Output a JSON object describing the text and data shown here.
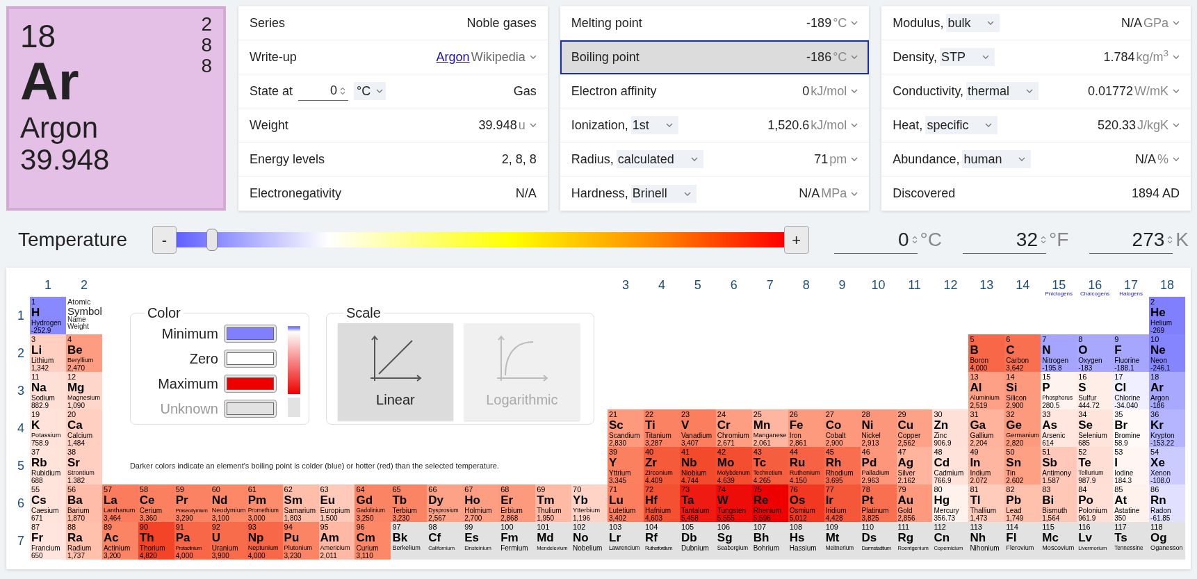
{
  "element_card": {
    "number": "18",
    "shells": [
      "2",
      "8",
      "8"
    ],
    "symbol": "Ar",
    "name": "Argon",
    "weight": "39.948"
  },
  "property_panels": [
    {
      "rows": [
        {
          "kind": "plain",
          "label": "Series",
          "value": "Noble gases",
          "menu": false
        },
        {
          "kind": "link",
          "label": "Write-up",
          "link": "Argon",
          "value": "Wikipedia",
          "menu": true
        },
        {
          "kind": "state",
          "label": "State at",
          "input": "0",
          "option": "°C",
          "value": "Gas",
          "menu": false
        },
        {
          "kind": "plain",
          "label": "Weight",
          "value": "39.948",
          "unit": "u",
          "menu": true
        },
        {
          "kind": "plain",
          "label": "Energy levels",
          "value": "2, 8, 8",
          "menu": false
        },
        {
          "kind": "plain",
          "label": "Electronegativity",
          "value": "N/A",
          "menu": false
        }
      ]
    },
    {
      "rows": [
        {
          "kind": "plain",
          "label": "Melting point",
          "value": "-189",
          "unit": "°C",
          "menu": true,
          "selected": false
        },
        {
          "kind": "plain",
          "label": "Boiling point",
          "value": "-186",
          "unit": "°C",
          "menu": true,
          "selected": true
        },
        {
          "kind": "plain",
          "label": "Electron affinity",
          "value": "0",
          "unit": "kJ/mol",
          "menu": true,
          "selected": false
        },
        {
          "kind": "plain",
          "label": "Ionization,",
          "option": "1st",
          "value": "1,520.6",
          "unit": "kJ/mol",
          "menu": true,
          "selected": false
        },
        {
          "kind": "plain",
          "label": "Radius,",
          "option": "calculated",
          "value": "71",
          "unit": "pm",
          "menu": true,
          "selected": false
        },
        {
          "kind": "plain",
          "label": "Hardness,",
          "option": "Brinell",
          "value": "N/A",
          "unit": "MPa",
          "menu": true,
          "selected": false
        }
      ]
    },
    {
      "rows": [
        {
          "kind": "plain",
          "label": "Modulus,",
          "option": "bulk",
          "value": "N/A",
          "unit": "GPa",
          "menu": true,
          "selected": false
        },
        {
          "kind": "plain",
          "label": "Density,",
          "option": "STP",
          "value": "1.784",
          "unit": "kg/m$^{3}$",
          "menu": true,
          "selected": false
        },
        {
          "kind": "plain",
          "label": "Conductivity,",
          "option": "thermal",
          "value": "0.01772",
          "unit": "W/mK",
          "menu": true,
          "selected": false
        },
        {
          "kind": "plain",
          "label": "Heat,",
          "option": "specific",
          "value": "520.33",
          "unit": "J/kgK",
          "menu": true,
          "selected": false
        },
        {
          "kind": "plain",
          "label": "Abundance,",
          "option": "human",
          "value": "N/A",
          "unit": "%",
          "menu": true,
          "selected": false
        },
        {
          "kind": "plain",
          "label": "Discovered",
          "value": "1894 AD",
          "menu": false,
          "selected": false
        }
      ]
    }
  ],
  "temperature": {
    "label": "Temperature",
    "minus": "-",
    "plus": "+",
    "level": 0.05,
    "fields": [
      {
        "value": "0",
        "unit": "°C"
      },
      {
        "value": "32",
        "unit": "°F"
      },
      {
        "value": "273",
        "unit": "K"
      }
    ]
  },
  "table": {
    "groups": [
      {
        "label": "1"
      },
      {
        "label": "2"
      },
      {
        "label": "3"
      },
      {
        "label": "4"
      },
      {
        "label": "5"
      },
      {
        "label": "6"
      },
      {
        "label": "7"
      },
      {
        "label": "8"
      },
      {
        "label": "9"
      },
      {
        "label": "10"
      },
      {
        "label": "11"
      },
      {
        "label": "12"
      },
      {
        "label": "13"
      },
      {
        "label": "14"
      },
      {
        "label": "15",
        "family": "Pnictogens"
      },
      {
        "label": "16",
        "family": "Chalcogens"
      },
      {
        "label": "17",
        "family": "Halogens"
      },
      {
        "label": "18"
      }
    ],
    "periods": [
      "1",
      "2",
      "3",
      "4",
      "5",
      "6",
      "7"
    ],
    "key": {
      "number": "Atomic",
      "symbol": "Symbol",
      "name": "Name",
      "value": "Weight"
    },
    "color_panel": {
      "title": "Color",
      "items": [
        {
          "label": "Minimum",
          "color": "#8080ff",
          "disabled": false
        },
        {
          "label": "Zero",
          "color": "#ffffff",
          "disabled": false
        },
        {
          "label": "Maximum",
          "color": "#ee0000",
          "disabled": false
        },
        {
          "label": "Unknown",
          "color": "#e2e2e2",
          "disabled": true
        }
      ]
    },
    "scale_panel": {
      "title": "Scale",
      "options": [
        {
          "kind": "linear",
          "label": "Linear",
          "selected": true
        },
        {
          "kind": "logarithmic",
          "label": "Logarithmic",
          "selected": false
        }
      ]
    },
    "note": "Darker colors indicate an element's boiling point is colder (blue) or hotter (red) than the selected temperature.",
    "elements": [
      {
        "number": "1",
        "symbol": "H",
        "name": "Hydrogen",
        "value": "-252.9",
        "color": "#8888ff"
      },
      {
        "number": "2",
        "symbol": "He",
        "name": "Helium",
        "value": "-269",
        "color": "#8080ff"
      },
      {
        "number": "3",
        "symbol": "Li",
        "name": "Lithium",
        "value": "1,342",
        "color": "#ffcfc1"
      },
      {
        "number": "4",
        "symbol": "Be",
        "name": "Beryllium",
        "value": "2,470",
        "color": "#fd9c80"
      },
      {
        "number": "5",
        "symbol": "B",
        "name": "Boron",
        "value": "4,000",
        "color": "#f86848"
      },
      {
        "number": "6",
        "symbol": "C",
        "name": "Carbon",
        "value": "3,642",
        "color": "#f87050"
      },
      {
        "number": "7",
        "symbol": "N",
        "name": "Nitrogen",
        "value": "-195.8",
        "color": "#a5a5ff"
      },
      {
        "number": "8",
        "symbol": "O",
        "name": "Oxygen",
        "value": "-183",
        "color": "#a8a8ff"
      },
      {
        "number": "9",
        "symbol": "F",
        "name": "Fluorine",
        "value": "-188.1",
        "color": "#a6a6ff"
      },
      {
        "number": "10",
        "symbol": "Ne",
        "name": "Neon",
        "value": "-246.1",
        "color": "#8585ff"
      },
      {
        "number": "11",
        "symbol": "Na",
        "name": "Sodium",
        "value": "882.9",
        "color": "#ffe0d8"
      },
      {
        "number": "12",
        "symbol": "Mg",
        "name": "Magnesium",
        "value": "1,090",
        "color": "#ffd6ca"
      },
      {
        "number": "13",
        "symbol": "Al",
        "name": "Aluminium",
        "value": "2,519",
        "color": "#fda085"
      },
      {
        "number": "14",
        "symbol": "Si",
        "name": "Silicon",
        "value": "2,900",
        "color": "#fd9a7e"
      },
      {
        "number": "15",
        "symbol": "P",
        "name": "Phosphorus",
        "value": "280.5",
        "color": "#fff3ef"
      },
      {
        "number": "16",
        "symbol": "S",
        "name": "Sulfur",
        "value": "444.72",
        "color": "#ffeee8"
      },
      {
        "number": "17",
        "symbol": "Cl",
        "name": "Chlorine",
        "value": "-34.040",
        "color": "#efefff"
      },
      {
        "number": "18",
        "symbol": "Ar",
        "name": "Argon",
        "value": "-186",
        "color": "#a8a8ff"
      },
      {
        "number": "19",
        "symbol": "K",
        "name": "Potassium",
        "value": "758.9",
        "color": "#ffe3db"
      },
      {
        "number": "20",
        "symbol": "Ca",
        "name": "Calcium",
        "value": "1,484",
        "color": "#ffcfc1"
      },
      {
        "number": "21",
        "symbol": "Sc",
        "name": "Scandium",
        "value": "2,830",
        "color": "#fd9a7e"
      },
      {
        "number": "22",
        "symbol": "Ti",
        "name": "Titanium",
        "value": "3,287",
        "color": "#fb8262"
      },
      {
        "number": "23",
        "symbol": "V",
        "name": "Vanadium",
        "value": "3,407",
        "color": "#fb7e5e"
      },
      {
        "number": "24",
        "symbol": "Cr",
        "name": "Chromium",
        "value": "2,671",
        "color": "#fd9e82"
      },
      {
        "number": "25",
        "symbol": "Mn",
        "name": "Manganese",
        "value": "2,061",
        "color": "#ffb6a0"
      },
      {
        "number": "26",
        "symbol": "Fe",
        "name": "Iron",
        "value": "2,861",
        "color": "#fd9a7e"
      },
      {
        "number": "27",
        "symbol": "Co",
        "name": "Cobalt",
        "value": "2,900",
        "color": "#fd987c"
      },
      {
        "number": "28",
        "symbol": "Ni",
        "name": "Nickel",
        "value": "2,913",
        "color": "#fd977b"
      },
      {
        "number": "29",
        "symbol": "Cu",
        "name": "Copper",
        "value": "2,562",
        "color": "#fda286"
      },
      {
        "number": "30",
        "symbol": "Zn",
        "name": "Zinc",
        "value": "906.9",
        "color": "#ffe0d8"
      },
      {
        "number": "31",
        "symbol": "Ga",
        "name": "Gallium",
        "value": "2,204",
        "color": "#ffb29c"
      },
      {
        "number": "32",
        "symbol": "Ge",
        "name": "Germanium",
        "value": "2,820",
        "color": "#fd9a7e"
      },
      {
        "number": "33",
        "symbol": "As",
        "name": "Arsenic",
        "value": "614",
        "color": "#ffe6de"
      },
      {
        "number": "34",
        "symbol": "Se",
        "name": "Selenium",
        "value": "685",
        "color": "#ffe4dc"
      },
      {
        "number": "35",
        "symbol": "Br",
        "name": "Bromine",
        "value": "58.9",
        "color": "#fffaf8"
      },
      {
        "number": "36",
        "symbol": "Kr",
        "name": "Krypton",
        "value": "-153.22",
        "color": "#b5b5ff"
      },
      {
        "number": "37",
        "symbol": "Rb",
        "name": "Rubidium",
        "value": "688",
        "color": "#ffe4dc"
      },
      {
        "number": "38",
        "symbol": "Sr",
        "name": "Strontium",
        "value": "1.382",
        "color": "#ffd0c2"
      },
      {
        "number": "39",
        "symbol": "Y",
        "name": "Yttrium",
        "value": "3.345",
        "color": "#fb8060"
      },
      {
        "number": "40",
        "symbol": "Zr",
        "name": "Zirconium",
        "value": "4.409",
        "color": "#f55a3a"
      },
      {
        "number": "41",
        "symbol": "Nb",
        "name": "Niobium",
        "value": "4.744",
        "color": "#f34a2c"
      },
      {
        "number": "42",
        "symbol": "Mo",
        "name": "Molybdenum",
        "value": "4.639",
        "color": "#f44e30"
      },
      {
        "number": "43",
        "symbol": "Tc",
        "name": "Technetium",
        "value": "4.265",
        "color": "#f65e40"
      },
      {
        "number": "44",
        "symbol": "Ru",
        "name": "Ruthenium",
        "value": "4.150",
        "color": "#f76244"
      },
      {
        "number": "45",
        "symbol": "Rh",
        "name": "Rhodium",
        "value": "3.695",
        "color": "#f86e4e"
      },
      {
        "number": "46",
        "symbol": "Pd",
        "name": "Palladium",
        "value": "2.963",
        "color": "#fd967a"
      },
      {
        "number": "47",
        "symbol": "Ag",
        "name": "Silver",
        "value": "2.162",
        "color": "#ffb49e"
      },
      {
        "number": "48",
        "symbol": "Cd",
        "name": "Cadmium",
        "value": "766.9",
        "color": "#ffe3db"
      },
      {
        "number": "49",
        "symbol": "In",
        "name": "Indium",
        "value": "2.072",
        "color": "#ffb6a0"
      },
      {
        "number": "50",
        "symbol": "Sn",
        "name": "Tin",
        "value": "2.602",
        "color": "#fda084"
      },
      {
        "number": "51",
        "symbol": "Sb",
        "name": "Antimony",
        "value": "1.587",
        "color": "#ffc8b8"
      },
      {
        "number": "52",
        "symbol": "Te",
        "name": "Tellurium",
        "value": "987.9",
        "color": "#ffded6"
      },
      {
        "number": "53",
        "symbol": "I",
        "name": "Iodine",
        "value": "184.3",
        "color": "#fff6f3"
      },
      {
        "number": "54",
        "symbol": "Xe",
        "name": "Xenon",
        "value": "-108.0",
        "color": "#cbcbff"
      },
      {
        "number": "55",
        "symbol": "Cs",
        "name": "Caesium",
        "value": "671",
        "color": "#ffe4dc"
      },
      {
        "number": "56",
        "symbol": "Ba",
        "name": "Barium",
        "value": "1,870",
        "color": "#ffbca8"
      },
      {
        "number": "57",
        "symbol": "La",
        "name": "Lanthanum",
        "value": "3,464",
        "color": "#fb7c5c"
      },
      {
        "number": "58",
        "symbol": "Ce",
        "name": "Cerium",
        "value": "3,360",
        "color": "#fb8060"
      },
      {
        "number": "59",
        "symbol": "Pr",
        "name": "Praseodymium",
        "value": "3,290",
        "color": "#fb8262"
      },
      {
        "number": "60",
        "symbol": "Nd",
        "name": "Neodymium",
        "value": "3,100",
        "color": "#fc8868"
      },
      {
        "number": "61",
        "symbol": "Pm",
        "name": "Promethium",
        "value": "3,000",
        "color": "#fc8c6c"
      },
      {
        "number": "62",
        "symbol": "Sm",
        "name": "Samarium",
        "value": "1,803",
        "color": "#ffbea9"
      },
      {
        "number": "63",
        "symbol": "Eu",
        "name": "Europium",
        "value": "1,500",
        "color": "#ffcab9"
      },
      {
        "number": "64",
        "symbol": "Gd",
        "name": "Gadolinium",
        "value": "3,250",
        "color": "#fb8464"
      },
      {
        "number": "65",
        "symbol": "Tb",
        "name": "Terbium",
        "value": "3,230",
        "color": "#fb8464"
      },
      {
        "number": "66",
        "symbol": "Dy",
        "name": "Dysprosium",
        "value": "2,567",
        "color": "#fda286"
      },
      {
        "number": "67",
        "symbol": "Ho",
        "name": "Holmium",
        "value": "2,700",
        "color": "#fd9e82"
      },
      {
        "number": "68",
        "symbol": "Er",
        "name": "Erbium",
        "value": "2,868",
        "color": "#fd9a7e"
      },
      {
        "number": "69",
        "symbol": "Tm",
        "name": "Thulium",
        "value": "1,950",
        "color": "#ffbaa6"
      },
      {
        "number": "70",
        "symbol": "Yb",
        "name": "Ytterbium",
        "value": "1,196",
        "color": "#ffd3c6"
      },
      {
        "number": "71",
        "symbol": "Lu",
        "name": "Lutetium",
        "value": "3,402",
        "color": "#fb7e5e"
      },
      {
        "number": "72",
        "symbol": "Hf",
        "name": "Hafnium",
        "value": "4,603",
        "color": "#f45032"
      },
      {
        "number": "73",
        "symbol": "Ta",
        "name": "Tantalum",
        "value": "5,458",
        "color": "#ef1a12"
      },
      {
        "number": "74",
        "symbol": "W",
        "name": "Tungsten",
        "value": "5,555",
        "color": "#ee0c08"
      },
      {
        "number": "75",
        "symbol": "Re",
        "name": "Rhenium",
        "value": "5,596",
        "color": "#ee0000"
      },
      {
        "number": "76",
        "symbol": "Os",
        "name": "Osmium",
        "value": "5,012",
        "color": "#f23820"
      },
      {
        "number": "77",
        "symbol": "Ir",
        "name": "Iridium",
        "value": "4,428",
        "color": "#f55838"
      },
      {
        "number": "78",
        "symbol": "Pt",
        "name": "Platinum",
        "value": "3,825",
        "color": "#f87050"
      },
      {
        "number": "79",
        "symbol": "Au",
        "name": "Gold",
        "value": "2,856",
        "color": "#fd9a7e"
      },
      {
        "number": "80",
        "symbol": "Hg",
        "name": "Mercury",
        "value": "356.73",
        "color": "#fff1ec"
      },
      {
        "number": "81",
        "symbol": "Tl",
        "name": "Thallium",
        "value": "1,473",
        "color": "#ffcbbb"
      },
      {
        "number": "82",
        "symbol": "Pb",
        "name": "Lead",
        "value": "1,749",
        "color": "#ffc0ac"
      },
      {
        "number": "83",
        "symbol": "Bi",
        "name": "Bismuth",
        "value": "1,564",
        "color": "#ffc8b6"
      },
      {
        "number": "84",
        "symbol": "Po",
        "name": "Polonium",
        "value": "961.9",
        "color": "#ffdfd6"
      },
      {
        "number": "85",
        "symbol": "At",
        "name": "Astatine",
        "value": "350",
        "color": "#fff1ec"
      },
      {
        "number": "86",
        "symbol": "Rn",
        "name": "Radon",
        "value": "-61.85",
        "color": "#e1e1ff"
      },
      {
        "number": "87",
        "symbol": "Fr",
        "name": "Francium",
        "value": "650",
        "color": "#ffe5dd"
      },
      {
        "number": "88",
        "symbol": "Ra",
        "name": "Radium",
        "value": "1,737",
        "color": "#ffc0ac"
      },
      {
        "number": "89",
        "symbol": "Ac",
        "name": "Actinium",
        "value": "3,200",
        "color": "#fb8464"
      },
      {
        "number": "90",
        "symbol": "Th",
        "name": "Thorium",
        "value": "4,820",
        "color": "#f34428"
      },
      {
        "number": "91",
        "symbol": "Pa",
        "name": "Protactinium",
        "value": "4,000",
        "color": "#f86848"
      },
      {
        "number": "92",
        "symbol": "U",
        "name": "Uranium",
        "value": "3,900",
        "color": "#f86c4c"
      },
      {
        "number": "93",
        "symbol": "Np",
        "name": "Neptunium",
        "value": "4,000",
        "color": "#f86848"
      },
      {
        "number": "94",
        "symbol": "Pu",
        "name": "Plutonium",
        "value": "3,230",
        "color": "#fb8464"
      },
      {
        "number": "95",
        "symbol": "Am",
        "name": "Americium",
        "value": "2,011",
        "color": "#ffb8a3"
      },
      {
        "number": "96",
        "symbol": "Cm",
        "name": "Curium",
        "value": "3,110",
        "color": "#fc8868"
      },
      {
        "number": "97",
        "symbol": "Bk",
        "name": "Berkelium",
        "color": "#e2e2e2"
      },
      {
        "number": "98",
        "symbol": "Cf",
        "name": "Californium",
        "color": "#e2e2e2"
      },
      {
        "number": "99",
        "symbol": "Es",
        "name": "Einsteinium",
        "color": "#e2e2e2"
      },
      {
        "number": "100",
        "symbol": "Fm",
        "name": "Fermium",
        "color": "#e2e2e2"
      },
      {
        "number": "101",
        "symbol": "Md",
        "name": "Mendelevium",
        "color": "#e2e2e2"
      },
      {
        "number": "102",
        "symbol": "No",
        "name": "Nobelium",
        "color": "#e2e2e2"
      },
      {
        "number": "103",
        "symbol": "Lr",
        "name": "Lawrencium",
        "color": "#e2e2e2"
      },
      {
        "number": "104",
        "symbol": "Rf",
        "name": "Rutherfordium",
        "color": "#e2e2e2"
      },
      {
        "number": "105",
        "symbol": "Db",
        "name": "Dubnium",
        "color": "#e2e2e2"
      },
      {
        "number": "106",
        "symbol": "Sg",
        "name": "Seaborgium",
        "color": "#e2e2e2"
      },
      {
        "number": "107",
        "symbol": "Bh",
        "name": "Bohrium",
        "color": "#e2e2e2"
      },
      {
        "number": "108",
        "symbol": "Hs",
        "name": "Hassium",
        "color": "#e2e2e2"
      },
      {
        "number": "109",
        "symbol": "Mt",
        "name": "Meitnerium",
        "color": "#e2e2e2"
      },
      {
        "number": "110",
        "symbol": "Ds",
        "name": "Darmstadtium",
        "color": "#e2e2e2"
      },
      {
        "number": "111",
        "symbol": "Rg",
        "name": "Roentgenium",
        "color": "#e2e2e2"
      },
      {
        "number": "112",
        "symbol": "Cn",
        "name": "Copernicium",
        "color": "#e2e2e2"
      },
      {
        "number": "113",
        "symbol": "Nh",
        "name": "Nihonium",
        "color": "#e2e2e2"
      },
      {
        "number": "114",
        "symbol": "Fl",
        "name": "Flerovium",
        "color": "#e2e2e2"
      },
      {
        "number": "115",
        "symbol": "Mc",
        "name": "Moscovium",
        "color": "#e2e2e2"
      },
      {
        "number": "116",
        "symbol": "Lv",
        "name": "Livermorium",
        "color": "#e2e2e2"
      },
      {
        "number": "117",
        "symbol": "Ts",
        "name": "Tennessine",
        "color": "#e2e2e2"
      },
      {
        "number": "118",
        "symbol": "Og",
        "name": "Oganesson",
        "color": "#e2e2e2"
      }
    ]
  }
}
